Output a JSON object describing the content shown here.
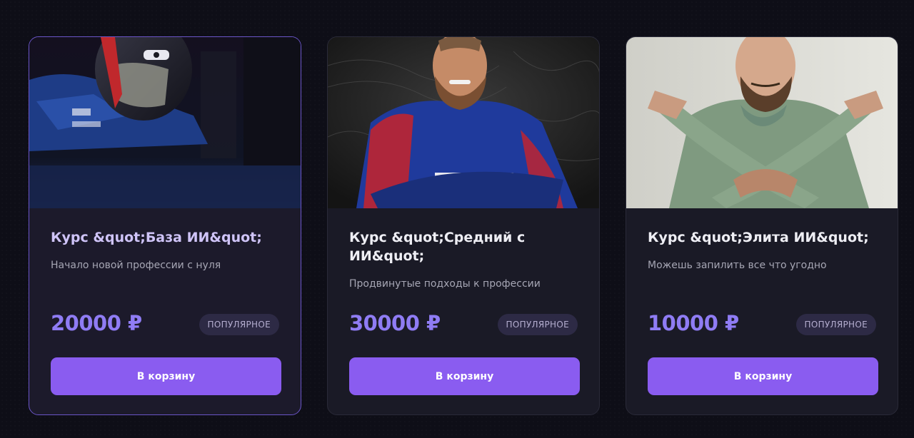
{
  "products": [
    {
      "title": "Курс &quot;База ИИ&quot;",
      "subtitle": "Начало новой профессии с нуля",
      "price": "20000 ₽",
      "badge": "ПОПУЛЯРНОЕ",
      "button": "В корзину"
    },
    {
      "title": "Курс &quot;Средний с ИИ&quot;",
      "subtitle": "Продвинутые подходы к профессии",
      "price": "30000 ₽",
      "badge": "ПОПУЛЯРНОЕ",
      "button": "В корзину"
    },
    {
      "title": "Курс &quot;Элита ИИ&quot;",
      "subtitle": "Можешь запилить все что угодно",
      "price": "10000 ₽",
      "badge": "ПОПУЛЯРНОЕ",
      "button": "В корзину"
    }
  ],
  "colors": {
    "accent": "#8a5cf0",
    "price": "#8f7cf4",
    "card_bg": "#1a1a26",
    "page_bg": "#0e0e17",
    "highlight_border": "#6a55c8"
  },
  "images": [
    "motorcycle-racer-helmet-photo",
    "racer-in-blue-suit-photo",
    "bearded-man-crossed-arms-photo"
  ]
}
